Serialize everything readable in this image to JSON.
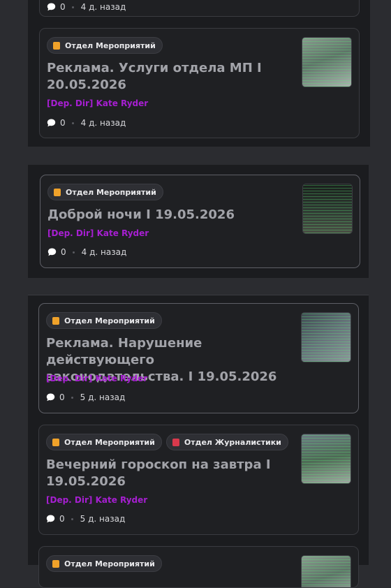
{
  "feed": {
    "top_partial": {
      "comments": "0",
      "time": "4 д. назад"
    },
    "posts": [
      {
        "tags": [
          {
            "label": "Отдел Мероприятий",
            "color": "#f0a22a"
          }
        ],
        "title": "Реклама. Услуги отдела МП I 20.05.2026",
        "author": "[Dep. Dir] Kate Ryder",
        "comments": "0",
        "time": "4 д. назад"
      },
      {
        "tags": [
          {
            "label": "Отдел Мероприятий",
            "color": "#f0a22a"
          }
        ],
        "title": "Доброй ночи I 19.05.2026",
        "author": "[Dep. Dir] Kate Ryder",
        "comments": "0",
        "time": "4 д. назад"
      },
      {
        "tags": [
          {
            "label": "Отдел Мероприятий",
            "color": "#f0a22a"
          }
        ],
        "title": "Реклама. Нарушение действующего законодательства. I 19.05.2026",
        "author": "[Dep. Dir] Kate Ryder",
        "comments": "0",
        "time": "5 д. назад"
      },
      {
        "tags": [
          {
            "label": "Отдел Мероприятий",
            "color": "#f0a22a"
          },
          {
            "label": "Отдел Журналистики",
            "color": "#d8394c"
          }
        ],
        "title": "Вечерний гороскоп на завтра I 19.05.2026",
        "author": "[Dep. Dir] Kate Ryder",
        "comments": "0",
        "time": "5 д. назад"
      },
      {
        "tags": [
          {
            "label": "Отдел Мероприятий",
            "color": "#f0a22a"
          }
        ]
      }
    ]
  },
  "colors": {
    "author": "#a61fd1",
    "tag_events": "#f0a22a",
    "tag_journalism": "#d8394c"
  }
}
